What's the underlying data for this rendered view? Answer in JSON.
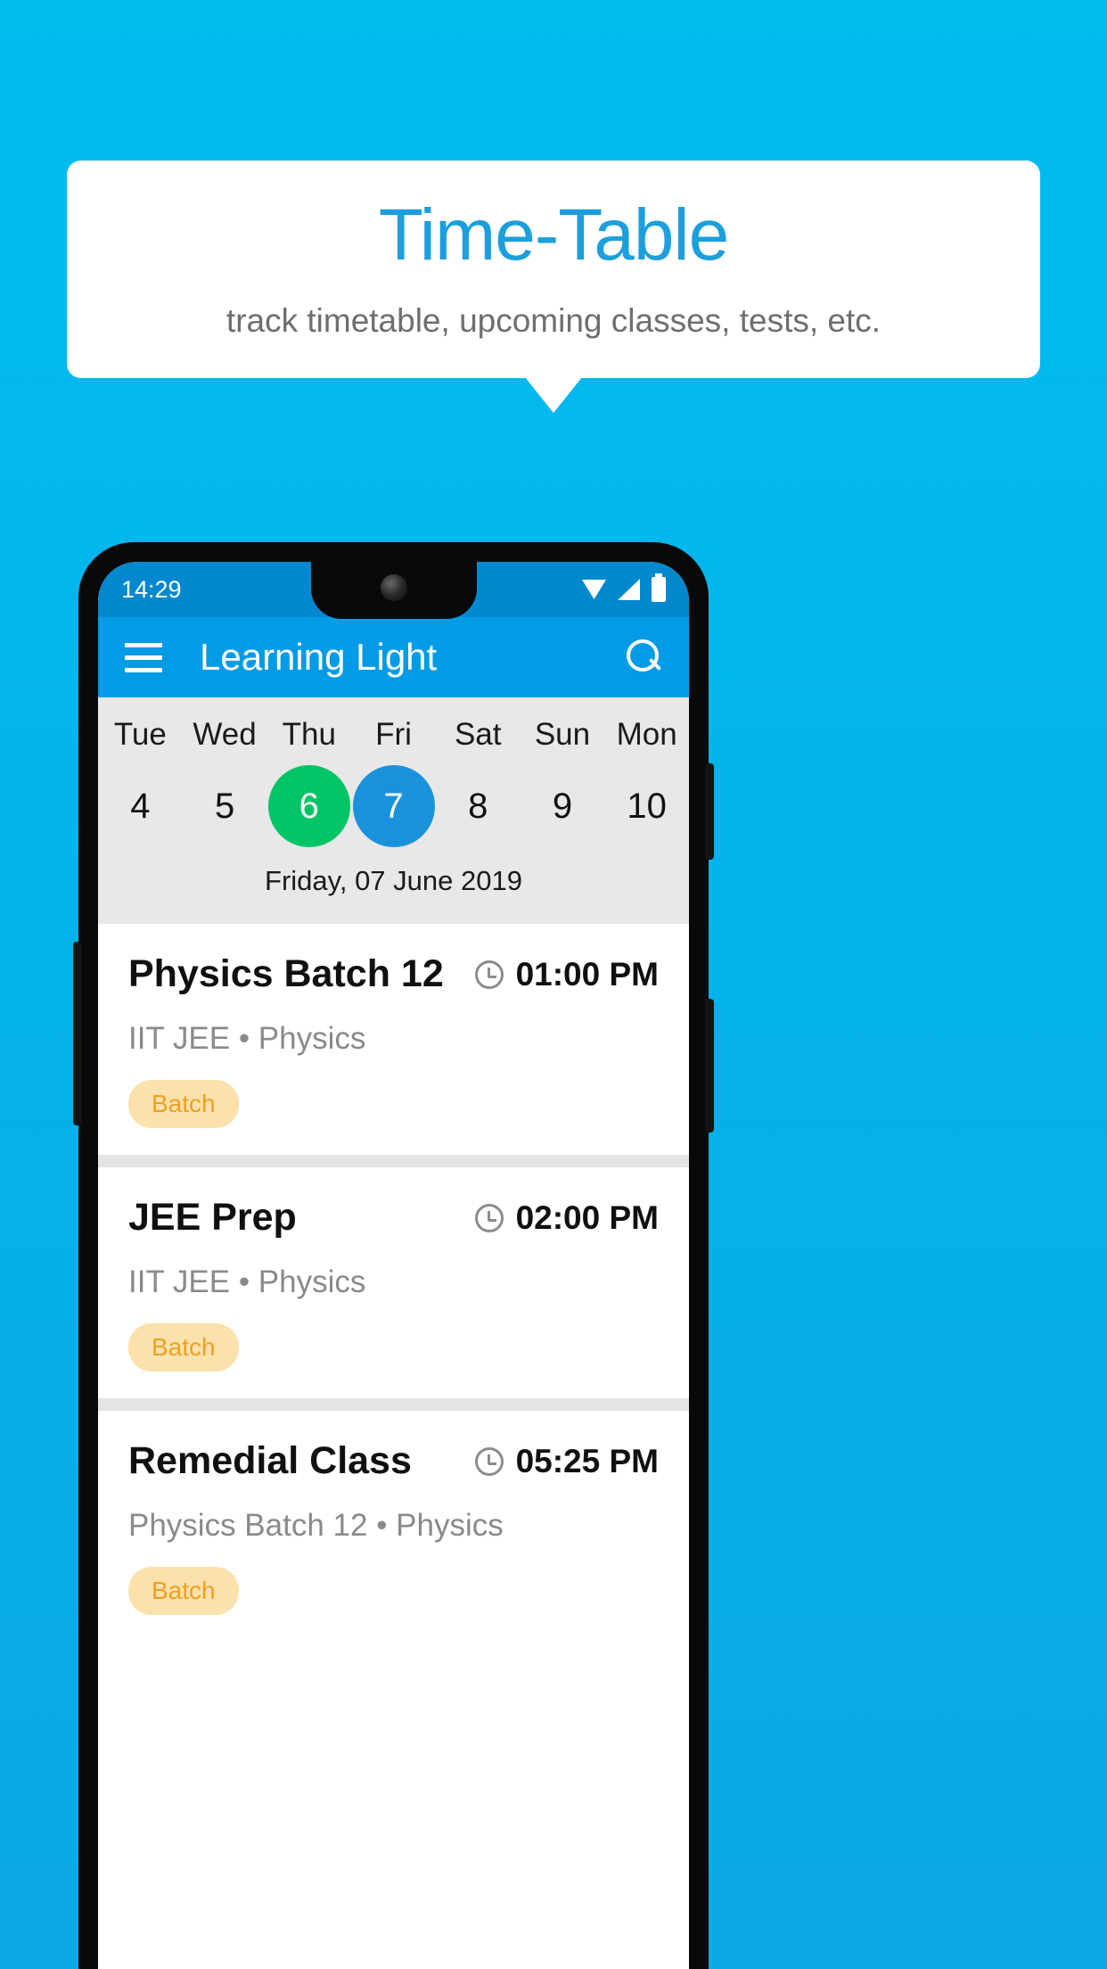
{
  "promo": {
    "title": "Time-Table",
    "subtitle": "track timetable, upcoming classes, tests, etc.",
    "title_color": "#1C9FDC",
    "background_color": "#00BDEF"
  },
  "phone": {
    "status_bar": {
      "time": "14:29",
      "icons": [
        "wifi-icon",
        "signal-icon",
        "battery-icon"
      ],
      "background_color": "#0288CE"
    },
    "app_bar": {
      "menu_icon": "hamburger-icon",
      "title": "Learning Light",
      "search_icon": "search-icon",
      "background_color": "#039BE5"
    },
    "date_strip": {
      "days": [
        {
          "label": "Tue",
          "number": "4",
          "state": "normal"
        },
        {
          "label": "Wed",
          "number": "5",
          "state": "normal"
        },
        {
          "label": "Thu",
          "number": "6",
          "state": "today"
        },
        {
          "label": "Fri",
          "number": "7",
          "state": "selected"
        },
        {
          "label": "Sat",
          "number": "8",
          "state": "normal"
        },
        {
          "label": "Sun",
          "number": "9",
          "state": "normal"
        },
        {
          "label": "Mon",
          "number": "10",
          "state": "normal"
        }
      ],
      "selected_date_label": "Friday, 07 June 2019",
      "today_color": "#00C566",
      "selected_color": "#1A92DB",
      "background_color": "#E8E8E8"
    },
    "schedule": [
      {
        "title": "Physics Batch 12",
        "time": "01:00 PM",
        "time_icon": "clock-icon",
        "subtitle": "IIT JEE • Physics",
        "chip": "Batch"
      },
      {
        "title": "JEE Prep",
        "time": "02:00 PM",
        "time_icon": "clock-icon",
        "subtitle": "IIT JEE • Physics",
        "chip": "Batch"
      },
      {
        "title": "Remedial Class",
        "time": "05:25 PM",
        "time_icon": "clock-icon",
        "subtitle": "Physics Batch 12 • Physics",
        "chip": "Batch"
      }
    ],
    "chip_colors": {
      "background": "#FBE2AC",
      "text": "#EDA022"
    }
  }
}
